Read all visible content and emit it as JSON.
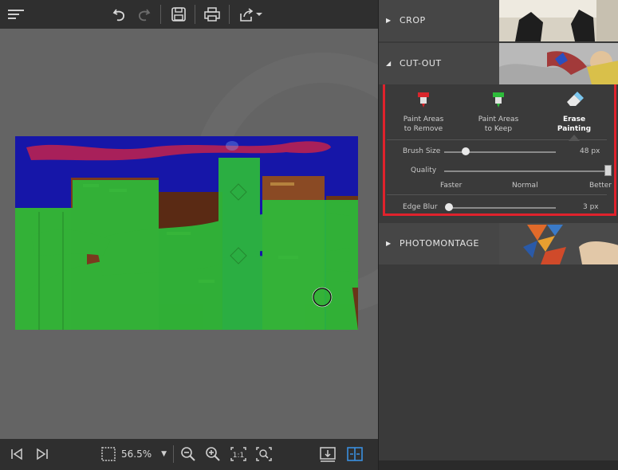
{
  "canvas": {
    "zoom": {
      "value": "56.5%"
    }
  },
  "panel": {
    "crop": {
      "title": "CROP"
    },
    "cutout": {
      "title": "CUT-OUT",
      "tools": [
        {
          "label": "Paint Areas\nto Remove",
          "color": "#d9262c"
        },
        {
          "label": "Paint Areas\nto Keep",
          "color": "#2dbb3a"
        },
        {
          "label": "Erase\nPainting",
          "color": "#7bc6ee",
          "active": true
        }
      ],
      "brush_size": {
        "label": "Brush Size",
        "value": "48 px",
        "level": 0.2
      },
      "quality": {
        "label": "Quality",
        "levels": [
          "Faster",
          "Normal",
          "Better"
        ],
        "level": 1.0
      },
      "edge_blur": {
        "label": "Edge Blur",
        "value": "3 px",
        "level": 0.03
      }
    },
    "photomontage": {
      "title": "PHOTOMONTAGE"
    }
  },
  "colors": {
    "highlight_border": "#e0222c",
    "remove_paint": "#d9262c",
    "keep_paint": "#2dbb3a",
    "sky": "#1616a8"
  }
}
